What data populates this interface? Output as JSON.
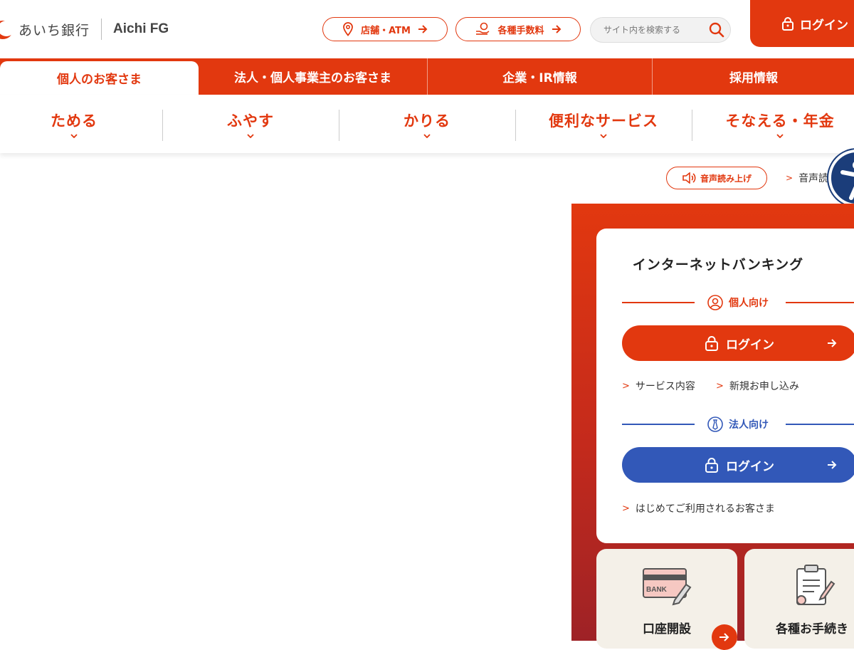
{
  "header": {
    "logo_text": "あいち銀行",
    "logo_fg": "Aichi FG",
    "store_atm": "店舗・ATM",
    "fees": "各種手数料",
    "search_placeholder": "サイト内を検索する",
    "login": "ログイン"
  },
  "tabs": [
    {
      "label": "個人のお客さま"
    },
    {
      "label": "法人・個人事業主のお客さま"
    },
    {
      "label": "企業・IR情報"
    },
    {
      "label": "採用情報"
    }
  ],
  "subnav": [
    {
      "label": "ためる"
    },
    {
      "label": "ふやす"
    },
    {
      "label": "かりる"
    },
    {
      "label": "便利なサービス"
    },
    {
      "label": "そなえる・年金"
    }
  ],
  "voice": {
    "button": "音声読み上げ",
    "link": "音声読"
  },
  "ib": {
    "title": "インターネットバンキング",
    "personal": {
      "label": "個人向け",
      "login": "ログイン",
      "links": [
        "サービス内容",
        "新規お申し込み"
      ]
    },
    "corporate": {
      "label": "法人向け",
      "login": "ログイン",
      "link": "はじめてご利用されるお客さま"
    }
  },
  "tiles": {
    "account": {
      "label": "口座開設",
      "icon_text": "BANK"
    },
    "procedures": {
      "label": "各種お手続き"
    }
  },
  "colors": {
    "brand_red": "#e2380f",
    "corp_blue": "#3258b8",
    "a11y_navy": "#1b3d7a"
  }
}
